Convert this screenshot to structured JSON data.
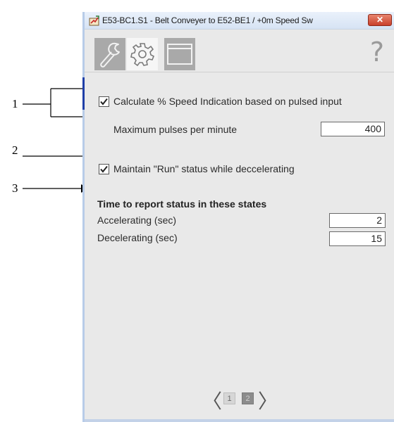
{
  "callouts": [
    "1",
    "2",
    "3"
  ],
  "window": {
    "title": "E53-BC1.S1 - Belt Conveyer to E52-BE1 / +0m Speed Sw",
    "close_label": "✕"
  },
  "toolbar": {
    "tabs": [
      {
        "icon": "wrench-icon"
      },
      {
        "icon": "gear-icon"
      },
      {
        "icon": "window-icon"
      }
    ],
    "help_label": "?"
  },
  "settings": {
    "calc_speed": {
      "label": "Calculate % Speed Indication based on pulsed input",
      "checked": true
    },
    "max_pulses": {
      "label": "Maximum pulses per minute",
      "value": "400"
    },
    "maintain_run": {
      "label": "Maintain \"Run\" status while deccelerating",
      "checked": true
    },
    "status_section": {
      "heading": "Time to report status in these states",
      "accelerating": {
        "label": "Accelerating (sec)",
        "value": "2"
      },
      "decelerating": {
        "label": "Decelerating (sec)",
        "value": "15"
      }
    }
  },
  "pager": {
    "prev": "〈",
    "next": "〉",
    "pages": [
      "1",
      "2"
    ],
    "current": "2"
  },
  "colors": {
    "close": "#c9402b",
    "selected_tab": "#f6f6f6",
    "unselected_tab": "#a9a9a9"
  }
}
